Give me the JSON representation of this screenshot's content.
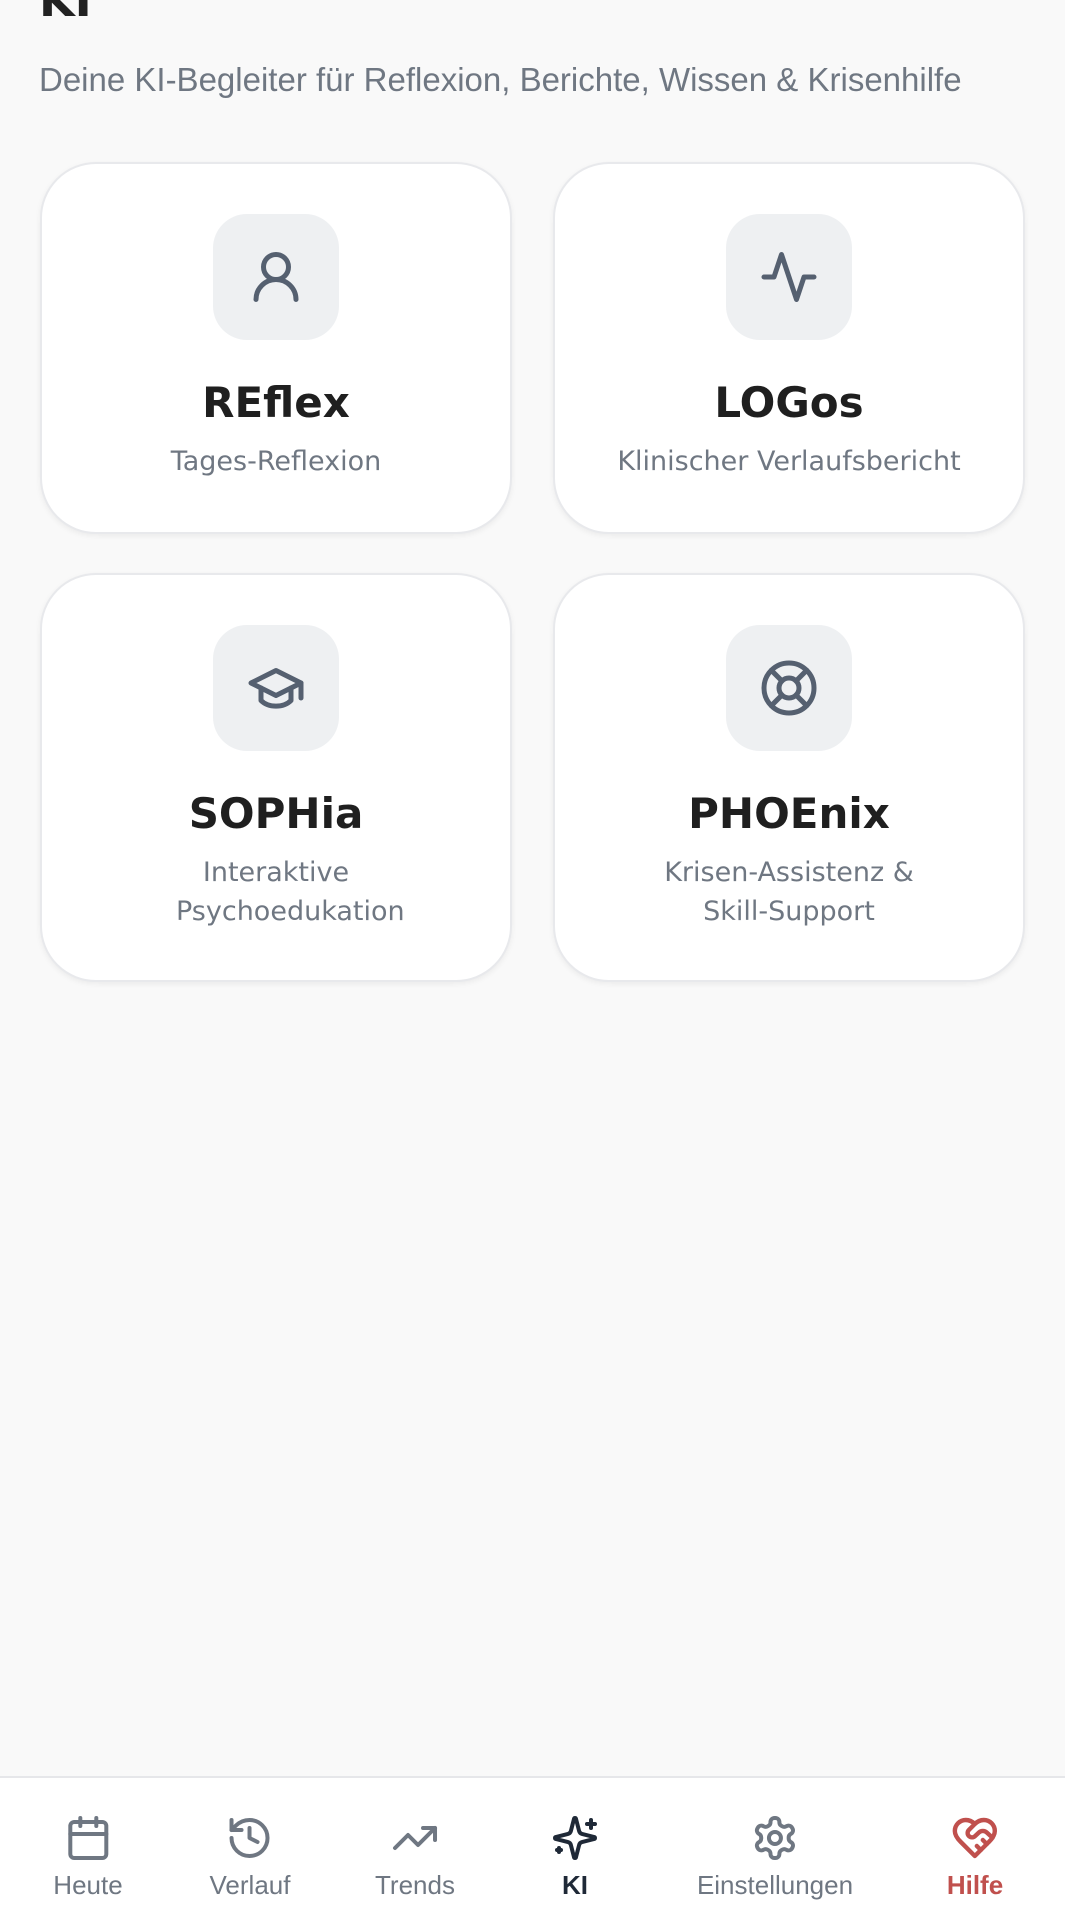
{
  "header": {
    "title": "KI",
    "subtitle": "Deine KI-Begleiter für Reflexion, Berichte, Wissen & Krisenhilfe"
  },
  "cards": [
    {
      "title": "REflex",
      "subtitle": "Tages-Reflexion",
      "icon": "user-icon"
    },
    {
      "title": "LOGos",
      "subtitle": "Klinischer Verlaufsbericht",
      "icon": "activity-icon"
    },
    {
      "title": "SOPHia",
      "subtitle": "Interaktive Psychoedukation",
      "icon": "graduation-cap-icon"
    },
    {
      "title": "PHOEnix",
      "subtitle": "Krisen-Assistenz & Skill-Support",
      "icon": "lifebuoy-icon"
    }
  ],
  "nav": {
    "items": [
      {
        "label": "Heute",
        "icon": "calendar-icon"
      },
      {
        "label": "Verlauf",
        "icon": "history-icon"
      },
      {
        "label": "Trends",
        "icon": "trending-up-icon"
      },
      {
        "label": "KI",
        "icon": "sparkles-icon",
        "active": true
      },
      {
        "label": "Einstellungen",
        "icon": "gear-icon"
      },
      {
        "label": "Hilfe",
        "icon": "heart-handshake-icon"
      }
    ]
  },
  "colors": {
    "background": "#f9f9f9",
    "card": "#ffffff",
    "icon_bg": "#eef0f2",
    "icon_stroke": "#556070",
    "muted_text": "#6f7782",
    "help_accent": "#c0504d"
  }
}
